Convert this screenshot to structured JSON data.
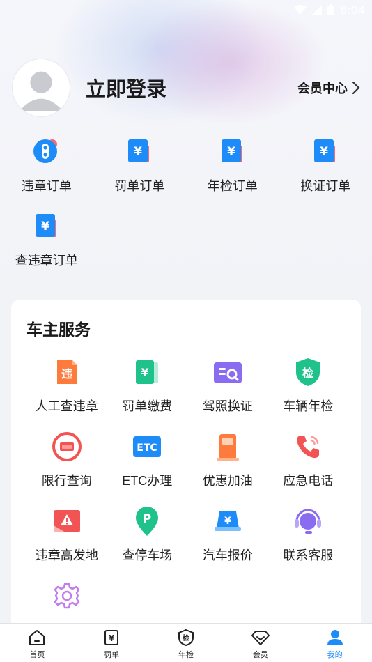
{
  "status_bar": {
    "time": "8:04"
  },
  "profile": {
    "login_label": "立即登录",
    "member_center_label": "会员中心"
  },
  "orders": [
    {
      "label": "违章订单",
      "icon": "traffic-light-icon"
    },
    {
      "label": "罚单订单",
      "icon": "yuan-bill-icon"
    },
    {
      "label": "年检订单",
      "icon": "yuan-bill-icon"
    },
    {
      "label": "换证订单",
      "icon": "yuan-bill-icon"
    },
    {
      "label": "查违章订单",
      "icon": "yuan-bill-icon"
    }
  ],
  "services": {
    "title": "车主服务",
    "items": [
      {
        "label": "人工查违章",
        "icon": "violation-doc-icon"
      },
      {
        "label": "罚单缴费",
        "icon": "fine-payment-icon"
      },
      {
        "label": "驾照换证",
        "icon": "license-search-icon"
      },
      {
        "label": "车辆年检",
        "icon": "inspection-shield-icon"
      },
      {
        "label": "限行查询",
        "icon": "restriction-sign-icon"
      },
      {
        "label": "ETC办理",
        "icon": "etc-icon"
      },
      {
        "label": "优惠加油",
        "icon": "fuel-pump-icon"
      },
      {
        "label": "应急电话",
        "icon": "phone-icon"
      },
      {
        "label": "违章高发地",
        "icon": "warning-map-icon"
      },
      {
        "label": "查停车场",
        "icon": "parking-pin-icon"
      },
      {
        "label": "汽车报价",
        "icon": "car-price-icon"
      },
      {
        "label": "联系客服",
        "icon": "headset-icon"
      },
      {
        "label": "",
        "icon": "settings-gear-icon"
      }
    ]
  },
  "tabs": [
    {
      "label": "首页",
      "icon": "home-icon",
      "active": false
    },
    {
      "label": "罚单",
      "icon": "fine-ticket-icon",
      "active": false
    },
    {
      "label": "年检",
      "icon": "inspection-icon",
      "active": false
    },
    {
      "label": "会员",
      "icon": "diamond-icon",
      "active": false
    },
    {
      "label": "我的",
      "icon": "user-icon",
      "active": true
    }
  ],
  "colors": {
    "accent_blue": "#1d8cf8",
    "orange": "#ff7a3d",
    "green": "#1fc28b",
    "purple": "#8a6cf0",
    "red": "#f25454"
  }
}
